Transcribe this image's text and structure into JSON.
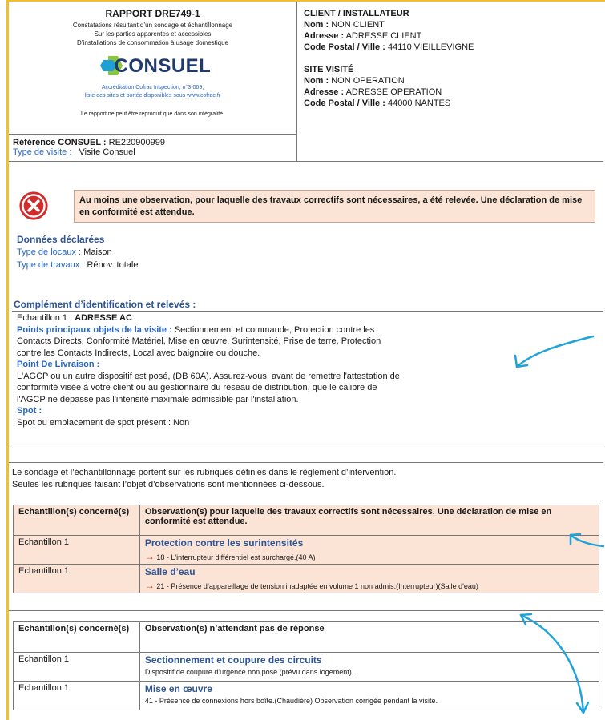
{
  "report": {
    "title": "RAPPORT DRE749-1",
    "subtitle_lines": [
      "Constatations résultant d’un sondage et échantillonnage",
      "Sur les parties apparentes et accessibles",
      "D’installations de consommation à usage domestique"
    ],
    "logo_text": "CONSUEL",
    "accreditation_lines": [
      "Accréditation Cofrac Inspection, n°3-069,",
      "liste des sites et portée disponibles sous www.cofrac.fr"
    ],
    "reproduction_note": "Le rapport ne peut être reproduit que dans son intégralité.",
    "reference_label": "Référence CONSUEL :",
    "reference_value": "RE220900999",
    "visit_type_label": "Type de visite :",
    "visit_type_value": "Visite Consuel"
  },
  "client": {
    "heading": "CLIENT / INSTALLATEUR",
    "name_label": "Nom :",
    "name_value": "NON CLIENT",
    "address_label": "Adresse :",
    "address_value": "ADRESSE CLIENT",
    "city_label": "Code Postal / Ville :",
    "city_value": "44110  VIEILLEVIGNE"
  },
  "site": {
    "heading": "SITE VISITÉ",
    "name_label": "Nom :",
    "name_value": "NON OPERATION",
    "address_label": "Adresse :",
    "address_value": "ADRESSE OPERATION",
    "city_label": "Code Postal / Ville :",
    "city_value": "44000  NANTES"
  },
  "alert": {
    "icon": "red-cross-icon",
    "text": "Au moins une observation, pour laquelle des travaux correctifs sont nécessaires, a été relevée. Une déclaration de mise en conformité est attendue."
  },
  "declared": {
    "title": "Données déclarées",
    "premises_label": "Type de locaux :",
    "premises_value": "Maison",
    "works_label": "Type de travaux :",
    "works_value": "Rénov. totale"
  },
  "complement": {
    "title": "Complément d’identification et relevés :",
    "sample_label": "Echantillon 1 :",
    "sample_value": "ADRESSE AC",
    "points_label": "Points principaux objets de la visite :",
    "points_lines": [
      "Sectionnement et commande, Protection contre les",
      "Contacts Directs, Conformité Matériel, Mise en œuvre, Surintensité, Prise de terre, Protection",
      "contre les Contacts Indirects, Local avec baignoire ou douche."
    ],
    "delivery_label": "Point De Livraison :",
    "delivery_lines": [
      "L'AGCP ou un autre dispositif est posé, (DB 60A). Assurez-vous, avant de remettre l'attestation de",
      "conformité visée à votre client ou au gestionnaire du réseau de distribution, que le calibre de",
      "l'AGCP ne dépasse pas l'intensité maximale admissible par l'installation."
    ],
    "spot_label": "Spot :",
    "spot_value": "Spot ou emplacement de spot présent : Non"
  },
  "info_lines": [
    "Le sondage et l’échantillonnage portent sur les rubriques définies dans le règlement d’intervention.",
    "Seules les rubriques faisant l’objet d’observations sont mentionnées ci-dessous."
  ],
  "table1": {
    "col1_header": "Echantillon(s) concerné(s)",
    "col2_header_bold": "Observation(s) pour laquelle des travaux correctifs sont nécessaires. Une déclaration de mise en conformité est attendue.",
    "rows": [
      {
        "sample": "Echantillon 1",
        "rubric": "Protection contre les surintensités",
        "observation": "18 - L'interrupteur différentiel est surchargé.(40 A)"
      },
      {
        "sample": "Echantillon 1",
        "rubric": "Salle d’eau",
        "observation": "21 - Présence d’appareillage de tension inadaptée en volume 1 non admis.(Interrupteur)(Salle d'eau)"
      }
    ]
  },
  "table2": {
    "col1_header": "Echantillon(s) concerné(s)",
    "col2_header": "Observation(s) n’attendant pas de réponse",
    "rows": [
      {
        "sample": "Echantillon 1",
        "rubric": "Sectionnement et coupure des circuits",
        "observation": "Dispositif de coupure d'urgence non posé (prévu dans logement)."
      },
      {
        "sample": "Echantillon 1",
        "rubric": "Mise en œuvre",
        "observation": "41 - Présence de connexions hors boîte.(Chaudière)    Observation corrigée pendant la visite."
      }
    ]
  },
  "colors": {
    "frame_yellow": "#f2bf2c",
    "highlight_peach": "#fbe4d5",
    "label_blue": "#2a66c4",
    "heading_blue": "#2e5597",
    "arrow_red": "#d93025",
    "annotation_cyan": "#1fa3d9"
  }
}
